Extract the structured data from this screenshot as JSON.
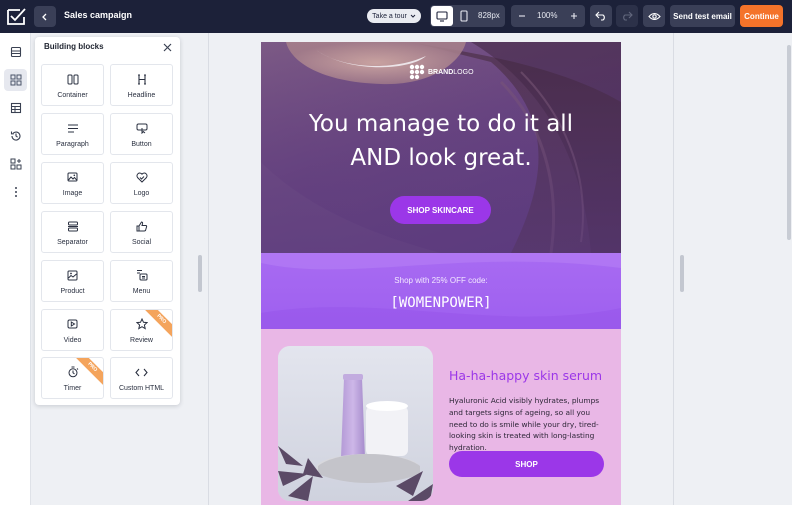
{
  "header": {
    "title": "Sales campaign",
    "tour_label": "Take a tour",
    "width_label": "828px",
    "zoom_label": "100%",
    "send_test_label": "Send test email",
    "continue_label": "Continue"
  },
  "panel": {
    "title": "Building blocks",
    "blocks": [
      {
        "label": "Container",
        "icon": "container-icon"
      },
      {
        "label": "Headline",
        "icon": "headline-icon"
      },
      {
        "label": "Paragraph",
        "icon": "paragraph-icon"
      },
      {
        "label": "Button",
        "icon": "button-icon"
      },
      {
        "label": "Image",
        "icon": "image-icon"
      },
      {
        "label": "Logo",
        "icon": "logo-icon"
      },
      {
        "label": "Separator",
        "icon": "separator-icon"
      },
      {
        "label": "Social",
        "icon": "social-icon"
      },
      {
        "label": "Product",
        "icon": "product-icon"
      },
      {
        "label": "Menu",
        "icon": "menu-icon"
      },
      {
        "label": "Video",
        "icon": "video-icon"
      },
      {
        "label": "Review",
        "icon": "review-icon",
        "badge": "PRO"
      },
      {
        "label": "Timer",
        "icon": "timer-icon",
        "badge": "PRO"
      },
      {
        "label": "Custom HTML",
        "icon": "code-icon"
      }
    ]
  },
  "email": {
    "brand_bold": "BRAND",
    "brand_light": "LOGO",
    "headline_line1": "You manage to do it all",
    "headline_line2": "AND look great.",
    "hero_cta": "SHOP SKINCARE",
    "promo_text": "Shop with 25% OFF code:",
    "promo_code": "[WOMENPOWER]",
    "product_title": "Ha-ha-happy skin serum",
    "product_desc": "Hyaluronic Acid visibly hydrates, plumps and targets signs of ageing, so all you need to do is smile while your dry, tired-looking skin is treated with long-lasting hydration.",
    "product_cta": "SHOP"
  },
  "colors": {
    "topbar": "#1c2139",
    "accent_orange": "#f4732a",
    "purple": "#9b37e8",
    "promo_purple": "#a86bf2",
    "product_pink": "#e9b7e6"
  }
}
